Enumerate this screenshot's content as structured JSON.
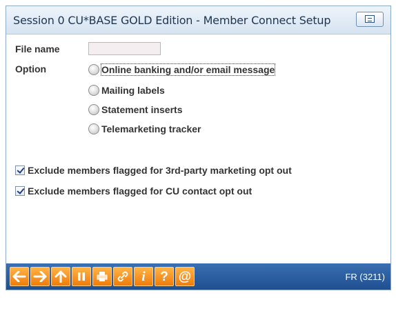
{
  "window": {
    "title": "Session 0 CU*BASE GOLD Edition - Member Connect Setup"
  },
  "form": {
    "file_name_label": "File name",
    "file_name_value": "",
    "option_label": "Option",
    "options": [
      {
        "label": "Online banking and/or email message",
        "selected": false,
        "focused": true
      },
      {
        "label": "Mailing labels",
        "selected": false
      },
      {
        "label": "Statement inserts",
        "selected": false
      },
      {
        "label": "Telemarketing tracker",
        "selected": false
      }
    ],
    "checkboxes": [
      {
        "label": "Exclude members flagged for 3rd-party marketing opt out",
        "checked": true
      },
      {
        "label": "Exclude members flagged for CU contact opt out",
        "checked": true
      }
    ]
  },
  "toolbar": {
    "buttons": [
      "back",
      "forward",
      "up",
      "pause",
      "print",
      "link",
      "info",
      "help",
      "at-sign"
    ],
    "screen_id": "FR (3211)"
  },
  "colors": {
    "toolbar_bg": "#2a5d9f",
    "toolbar_button": "#f5901e",
    "title_text": "#1e3550"
  }
}
